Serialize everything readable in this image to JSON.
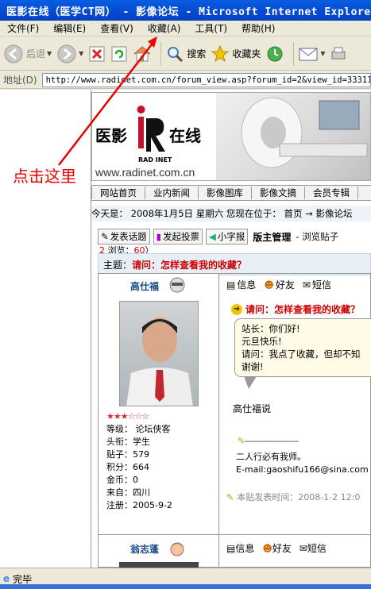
{
  "window": {
    "title": "医影在线（医学CT网） - 影像论坛 - Microsoft Internet Explorer"
  },
  "menu": {
    "items": [
      "文件(F)",
      "编辑(E)",
      "查看(V)",
      "收藏(A)",
      "工具(T)",
      "帮助(H)"
    ]
  },
  "toolbar": {
    "back": "后退",
    "search": "搜索",
    "favorites": "收藏夹"
  },
  "address": {
    "label": "地址(D)",
    "url": "http://www.radinet.com.cn/forum_view.asp?forum_id=2&view_id=33311"
  },
  "banner": {
    "logo_left": "医影",
    "logo_right": "在线",
    "logo_sub": "RAD INET",
    "logo_url": "www.radinet.com.cn"
  },
  "nav": {
    "items": [
      "网站首页",
      "业内新闻",
      "影像图库",
      "影像文摘",
      "会员专辑"
    ]
  },
  "datebar": {
    "text": "今天是： 2008年1月5日 星期六  您现在位于： 首页 → 影像论坛"
  },
  "actions": {
    "new_topic": "发表话题",
    "new_poll": "发起投票",
    "small_font": "小字报",
    "manager": "版主管理",
    "browse": "- 浏览贴子"
  },
  "stats": {
    "replies": "2",
    "views_label": " 浏览：",
    "views": "60",
    "close": "）"
  },
  "topic": {
    "label": "主题：",
    "title": "请问：怎样查看我的收藏？"
  },
  "post1": {
    "author": "高仕福",
    "stars": "★★★☆☆☆",
    "info": [
      "等级：  论坛侠客",
      "头衔：学生",
      "贴子：579",
      "积分：664",
      "金币：0",
      "来自：四川",
      "注册：2005-9-2"
    ],
    "tools": [
      "信息",
      "好友",
      "短信"
    ],
    "reply_title": "请问：怎样查看我的收藏？",
    "bubble_lines": [
      "站长：你们好!",
      "    元旦快乐!",
      "    请问：我点了收藏，但却不知",
      "    谢谢!"
    ],
    "signed": "高仕福说",
    "sig_line": "-----------------------",
    "sig_lines": [
      "二人行必有我师。",
      "E-mail:gaoshifu166@sina.com"
    ],
    "time": "本贴发表时间：2008-1-2 12:0"
  },
  "post2": {
    "author": "翁志蓬",
    "tools": [
      "信息",
      "好友",
      "短信"
    ]
  },
  "annotation": {
    "label": "点击这里"
  },
  "status": {
    "text": "完毕"
  }
}
